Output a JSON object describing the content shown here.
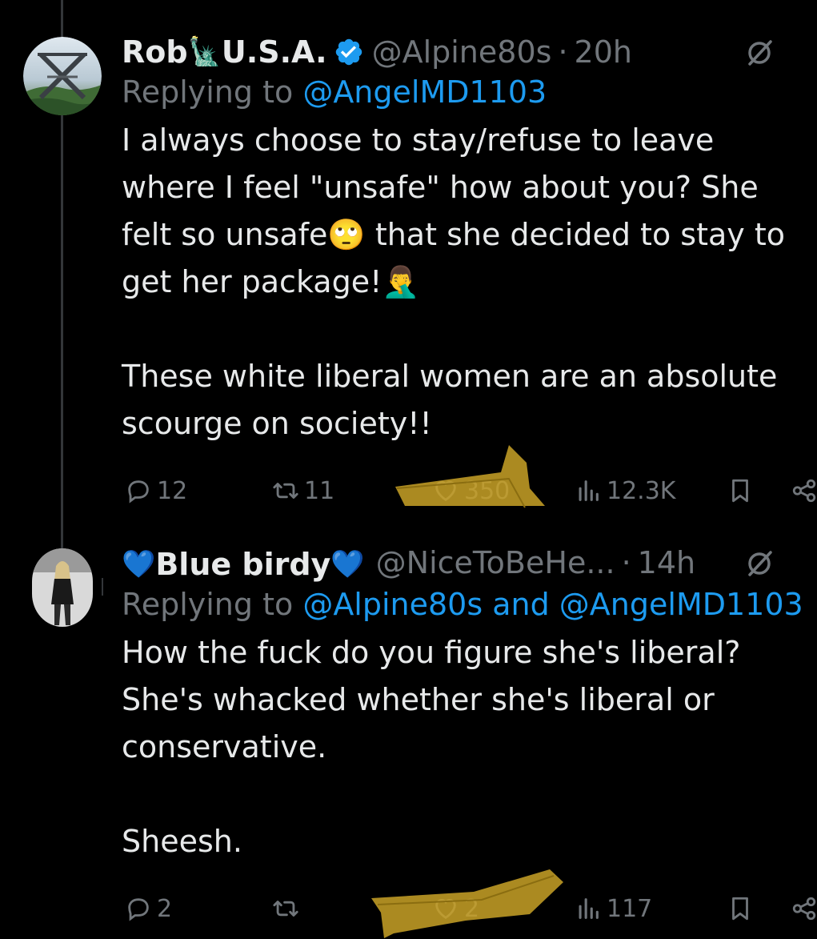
{
  "tweets": [
    {
      "display_name": "Rob",
      "name_emoji": "🗽",
      "name_suffix": "U.S.A.",
      "handle": "@Alpine80s",
      "separator": "·",
      "time": "20h",
      "reply_prefix": "Replying to ",
      "reply_mentions": "@AngelMD1103",
      "text": "I always choose to stay/refuse to leave where I feel \"unsafe\" how about you? She felt so unsafe🙄 that she decided to stay to get her package!🤦‍♂️\n\nThese white liberal women are an absolute scourge on society!!",
      "replies": "12",
      "retweets": "11",
      "likes": "350",
      "views": "12.3K"
    },
    {
      "name_prefix_emoji": "💙",
      "display_name": "Blue birdy",
      "name_emoji": "💙",
      "handle": "@NiceToBeHe...",
      "separator": "·",
      "time": "14h",
      "reply_prefix": "Replying to ",
      "reply_mentions": "@Alpine80s and @AngelMD1103",
      "text": "How the fuck do you figure she's liberal? She's whacked whether she's liberal or conservative.\n\nSheesh.",
      "replies": "2",
      "retweets": "",
      "likes": "2",
      "views": "117"
    }
  ],
  "colors": {
    "background": "#000000",
    "text": "#e7e9ea",
    "secondary": "#71767b",
    "link": "#1d9bf0",
    "verified": "#1d9bf0",
    "redaction": "#c9a227"
  }
}
